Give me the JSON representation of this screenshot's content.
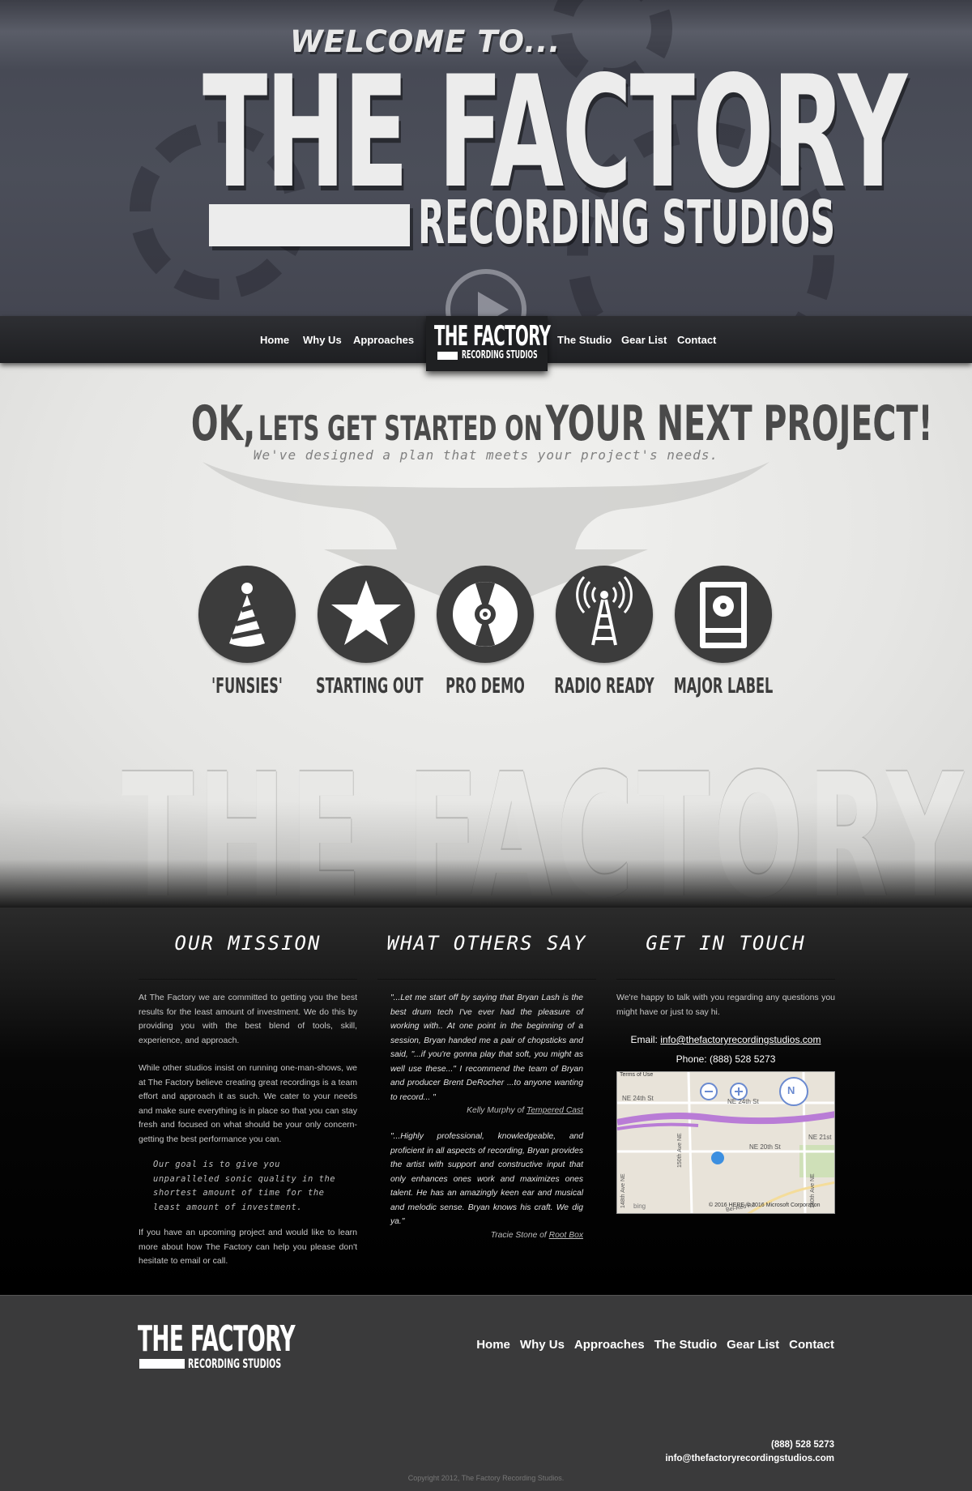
{
  "hero": {
    "welcome": "WELCOME TO...",
    "logo_title": "THE FACTORY",
    "logo_subtitle": "RECORDING STUDIOS"
  },
  "nav": {
    "items_left": [
      "Home",
      "Why Us",
      "Approaches"
    ],
    "items_right": [
      "The Studio",
      "Gear List",
      "Contact"
    ],
    "logo_title": "THE FACTORY",
    "logo_subtitle": "RECORDING STUDIOS"
  },
  "plans_section": {
    "headline_part1": "OK,",
    "headline_part2": "LETS GET STARTED ON",
    "headline_part3": "YOUR NEXT PROJECT!",
    "subtitle": "We've designed a plan that meets your project's needs.",
    "plans": [
      {
        "label": "'FUNSIES'",
        "icon": "party-hat-icon"
      },
      {
        "label": "STARTING OUT",
        "icon": "star-icon"
      },
      {
        "label": "PRO DEMO",
        "icon": "cd-icon"
      },
      {
        "label": "RADIO READY",
        "icon": "radio-tower-icon"
      },
      {
        "label": "MAJOR LABEL",
        "icon": "speaker-icon"
      }
    ],
    "watermark": "THE FACTORY"
  },
  "mission": {
    "heading": "OUR MISSION",
    "p1": "At The Factory we are committed to getting you the best results for the least amount of investment. We do this by providing you with the best blend of tools, skill, experience, and approach.",
    "p2": "While other studios insist on running one-man-shows, we at The Factory believe creating great recordings is a team effort and approach it as such. We cater to your needs and make sure everything is in place so that you can stay fresh and focused on what should be your only concern-getting the best performance you can.",
    "quote": "Our goal is to give you unparalleled sonic quality in the shortest amount of time for the least amount of investment.",
    "p3": "If you have an upcoming project and would like to learn more about how The Factory can help you please don't hesitate to email or call."
  },
  "testimonials": {
    "heading": "WHAT OTHERS SAY",
    "items": [
      {
        "text": "\"...Let me start off by saying that Bryan Lash is the best drum tech I've ever had the pleasure of working with.. At one point in the beginning of a session, Bryan handed me a pair of chopsticks and said, \"...if you're gonna play that soft, you might as well use these...\" I recommend the team of Bryan and producer Brent DeRocher ...to anyone wanting to record... \"",
        "author": "Kelly Murphy of",
        "band": "Tempered Cast"
      },
      {
        "text": "\"...Highly professional, knowledgeable, and proficient in all aspects of recording, Bryan provides the artist with support and constructive input that only enhances ones work and maximizes ones talent. He has an amazingly keen ear and musical and melodic sense. Bryan knows his craft. We dig ya.\"",
        "author": "Tracie Stone of",
        "band": "Root Box"
      }
    ]
  },
  "contact": {
    "heading": "GET IN TOUCH",
    "intro": "We're happy to talk with you regarding any questions you might have or just to say hi.",
    "email_label": "Email:",
    "email": "info@thefactoryrecordingstudios.com",
    "phone_label": "Phone:",
    "phone": "(888) 528 5273",
    "map": {
      "terms": "Terms of Use",
      "street1": "NE 24th St",
      "street2": "NE 24th St",
      "street3": "NE 20th St",
      "street4": "NE 21st",
      "street5": "150th Ave NE",
      "street6": "148th Ave NE",
      "street7": "140th Ave NE",
      "street8": "Bel-Red Rd",
      "compass": "N",
      "bing": "bing",
      "copyright": "© 2016 HERE   © 2016 Microsoft Corporation"
    }
  },
  "footer": {
    "logo_title": "THE FACTORY",
    "logo_subtitle": "RECORDING STUDIOS",
    "nav": [
      "Home",
      "Why Us",
      "Approaches",
      "The Studio",
      "Gear List",
      "Contact"
    ],
    "phone": "(888) 528 5273",
    "email": "info@thefactoryrecordingstudios.com",
    "copyright": "Copyright 2012, The Factory Recording Studios."
  }
}
